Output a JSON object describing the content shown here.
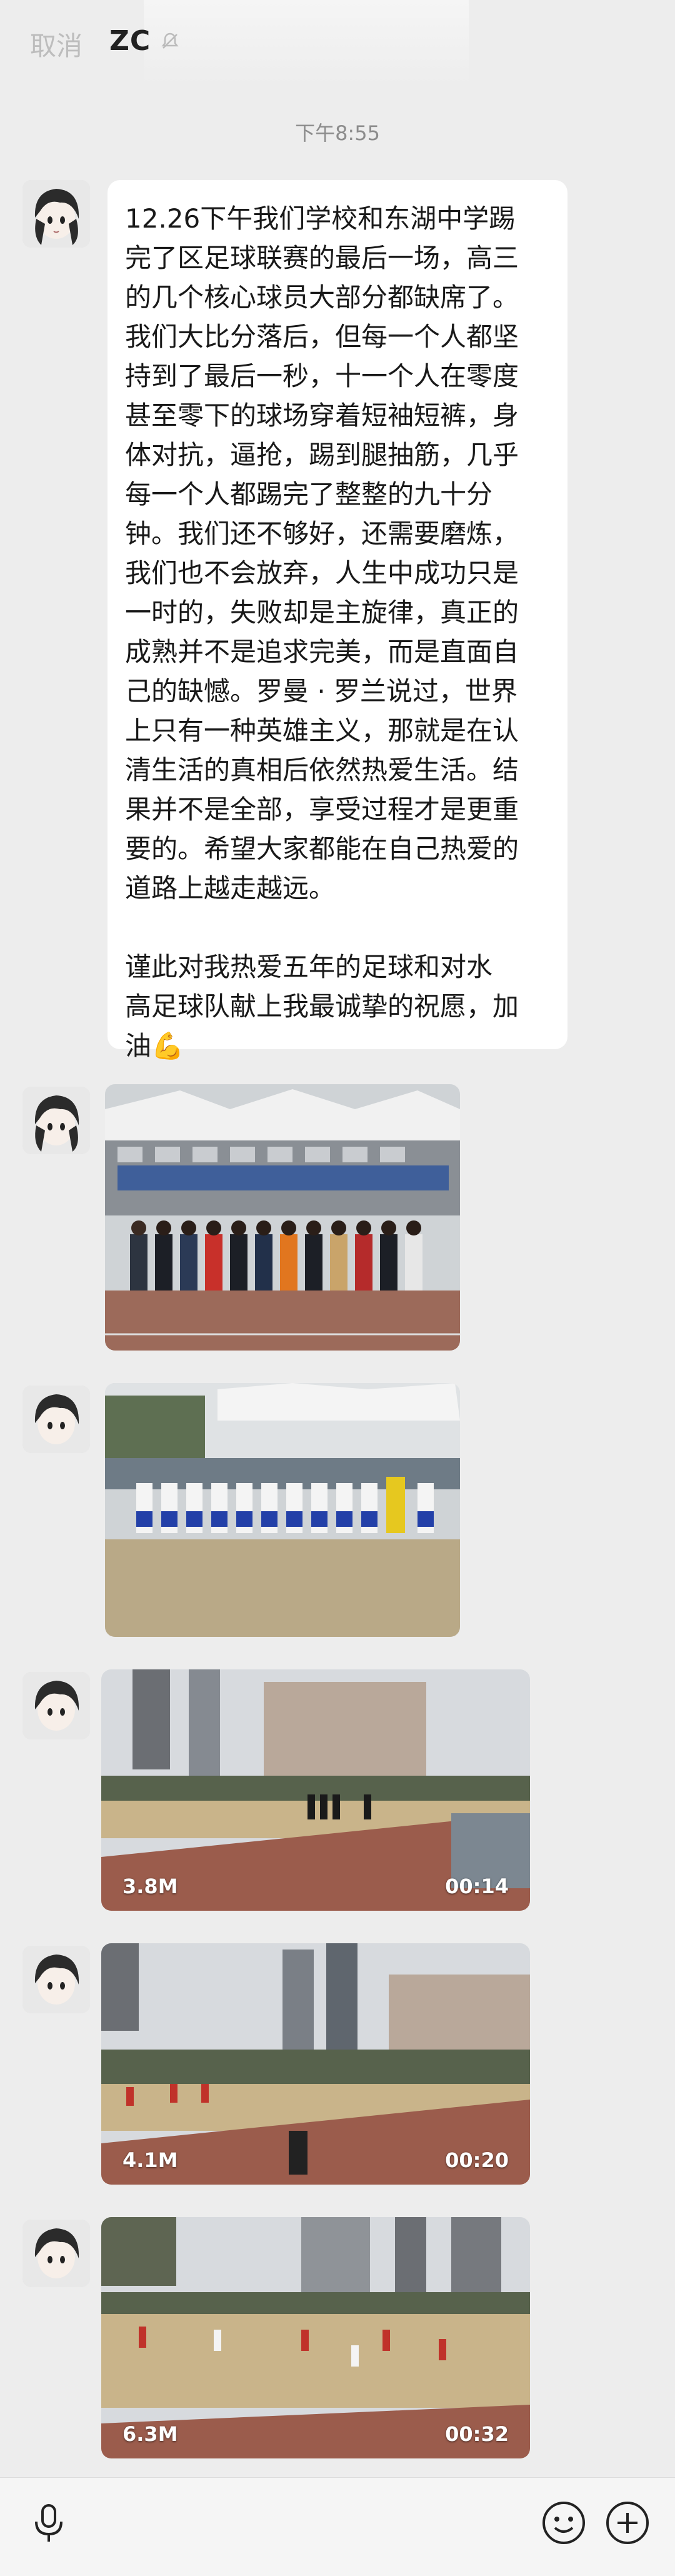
{
  "header": {
    "cancel_label": "取消",
    "title": "ZC",
    "title_icon": "bell-mute-icon"
  },
  "timestamp": "下午8:55",
  "message": {
    "lines": [
      "12.26下午我们学校和东湖中学踢",
      "完了区足球联赛的最后一场，高三",
      "的几个核心球员大部分都缺席了。",
      "我们大比分落后，但每一个人都坚",
      "持到了最后一秒，十一个人在零度",
      "甚至零下的球场穿着短袖短裤，身",
      "体对抗，逼抢，踢到腿抽筋，几乎",
      "每一个人都踢完了整整的九十分",
      "钟。我们还不够好，还需要磨炼，",
      "我们也不会放弃，人生中成功只是",
      "一时的，失败却是主旋律，真正的",
      "成熟并不是追求完美，而是直面自",
      "己的缺憾。罗曼 · 罗兰说过，世界",
      "上只有一种英雄主义，那就是在认",
      "清生活的真相后依然热爱生活。结",
      "果并不是全部，享受过程才是更重",
      "要的。希望大家都能在自己热爱的",
      "道路上越走越远。",
      "",
      "谨此对我热爱五年的足球和对水",
      "高足球队献上我最诚挚的祝愿，加",
      "油💪"
    ]
  },
  "media": [
    {
      "type": "image",
      "alt": "team-photo-group"
    },
    {
      "type": "image",
      "alt": "team-photo-field"
    },
    {
      "type": "video",
      "size": "3.8M",
      "duration": "00:14"
    },
    {
      "type": "video",
      "size": "4.1M",
      "duration": "00:20"
    },
    {
      "type": "video",
      "size": "6.3M",
      "duration": "00:32"
    }
  ],
  "input_bar": {
    "voice_icon": "microphone-icon",
    "emoji_icon": "emoji-icon",
    "more_icon": "plus-circle-icon"
  },
  "colors": {
    "background": "#ededed",
    "bubble": "#ffffff",
    "timestamp": "#8c8c8c"
  }
}
